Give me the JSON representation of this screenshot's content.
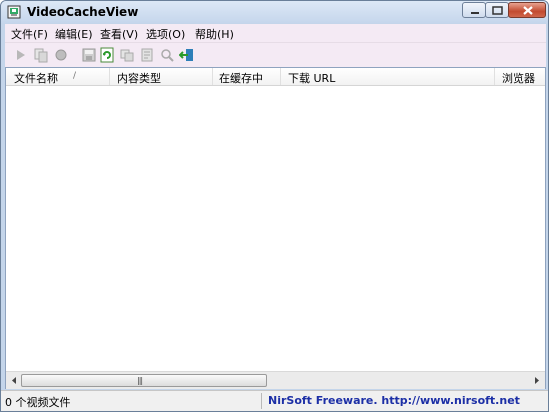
{
  "window": {
    "title": "VideoCacheView"
  },
  "menu": [
    {
      "label": "文件(F)"
    },
    {
      "label": "编辑(E)"
    },
    {
      "label": "查看(V)"
    },
    {
      "label": "选项(O)"
    },
    {
      "label": "帮助(H)"
    }
  ],
  "toolbar": [
    {
      "icon": "play-icon",
      "enabled": false
    },
    {
      "icon": "copy-file-icon",
      "enabled": false
    },
    {
      "icon": "record-icon",
      "enabled": false
    },
    {
      "icon": "save-icon",
      "enabled": false
    },
    {
      "icon": "refresh-icon",
      "enabled": true
    },
    {
      "icon": "copy-icon",
      "enabled": false
    },
    {
      "icon": "properties-icon",
      "enabled": false
    },
    {
      "icon": "find-icon",
      "enabled": false
    },
    {
      "icon": "exit-icon",
      "enabled": true
    }
  ],
  "columns": [
    {
      "label": "文件名称"
    },
    {
      "label": "内容类型"
    },
    {
      "label": "在缓存中"
    },
    {
      "label": "下载 URL"
    },
    {
      "label": "浏览器"
    }
  ],
  "rows": [],
  "status": {
    "count_text": "0 个视频文件",
    "credit_text": "NirSoft Freeware.  http://www.nirsoft.net"
  },
  "colors": {
    "menubar_bg": "#f4eaf4",
    "frame": "#c4d5ea",
    "credit_link": "#1c2fa6"
  }
}
